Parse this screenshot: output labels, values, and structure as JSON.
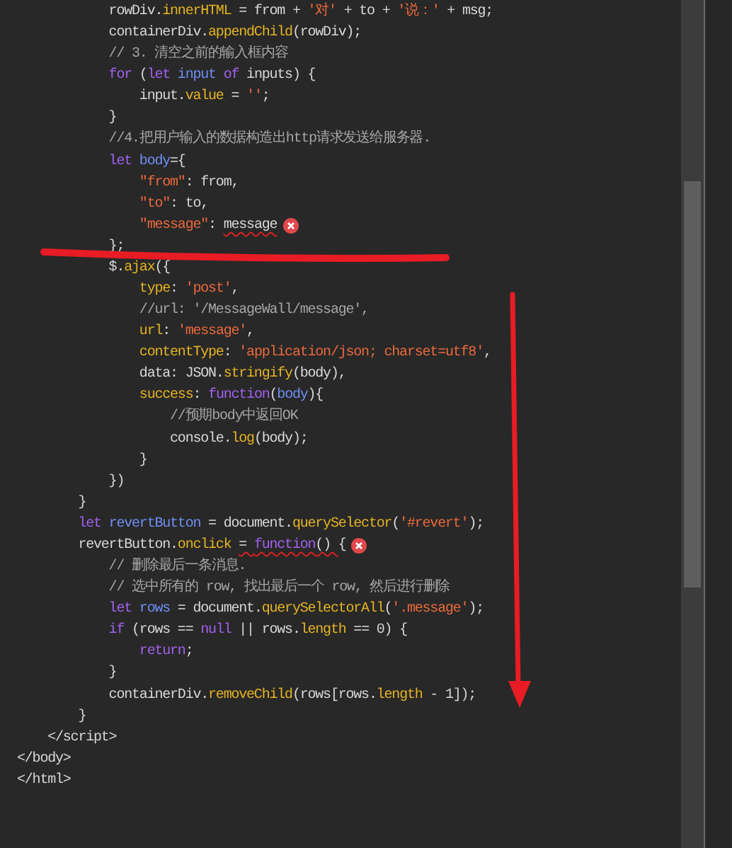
{
  "code_lines": [
    {
      "tokens": [
        {
          "t": "            rowDiv.",
          "kind": "plain"
        },
        {
          "t": "innerHTML",
          "kind": "prop"
        },
        {
          "t": " = from + ",
          "kind": "plain"
        },
        {
          "t": "'对'",
          "kind": "string"
        },
        {
          "t": " + to + ",
          "kind": "plain"
        },
        {
          "t": "'说：'",
          "kind": "string"
        },
        {
          "t": " + msg;",
          "kind": "plain"
        }
      ]
    },
    {
      "tokens": [
        {
          "t": "            containerDiv.",
          "kind": "plain"
        },
        {
          "t": "appendChild",
          "kind": "prop"
        },
        {
          "t": "(rowDiv);",
          "kind": "plain"
        }
      ]
    },
    {
      "tokens": [
        {
          "t": "            // 3. 清空之前的输入框内容",
          "kind": "comment"
        }
      ]
    },
    {
      "tokens": [
        {
          "t": "            for",
          "kind": "keyword"
        },
        {
          "t": " (",
          "kind": "plain"
        },
        {
          "t": "let",
          "kind": "keyword"
        },
        {
          "t": " input",
          "kind": "decl"
        },
        {
          "t": " of",
          "kind": "keyword"
        },
        {
          "t": " inputs) {",
          "kind": "plain"
        }
      ]
    },
    {
      "tokens": [
        {
          "t": "                input.",
          "kind": "plain"
        },
        {
          "t": "value",
          "kind": "prop"
        },
        {
          "t": " = ",
          "kind": "plain"
        },
        {
          "t": "''",
          "kind": "string"
        },
        {
          "t": ";",
          "kind": "plain"
        }
      ]
    },
    {
      "tokens": [
        {
          "t": "            }",
          "kind": "plain"
        }
      ]
    },
    {
      "tokens": [
        {
          "t": "            //4.把用户输入的数据构造出http请求发送给服务器.",
          "kind": "comment"
        }
      ]
    },
    {
      "tokens": [
        {
          "t": "            let",
          "kind": "keyword"
        },
        {
          "t": " body",
          "kind": "decl"
        },
        {
          "t": "={",
          "kind": "plain"
        }
      ]
    },
    {
      "tokens": [
        {
          "t": "                \"from\"",
          "kind": "string"
        },
        {
          "t": ": from,",
          "kind": "plain"
        }
      ]
    },
    {
      "tokens": [
        {
          "t": "                \"to\"",
          "kind": "string"
        },
        {
          "t": ": to,",
          "kind": "plain"
        }
      ]
    },
    {
      "tokens": [
        {
          "t": "                \"message\"",
          "kind": "string"
        },
        {
          "t": ": ",
          "kind": "plain"
        },
        {
          "t": "message",
          "kind": "plain",
          "squiggle": true
        }
      ],
      "error": true
    },
    {
      "tokens": [
        {
          "t": "            };",
          "kind": "plain"
        }
      ]
    },
    {
      "tokens": [
        {
          "t": "            $.",
          "kind": "plain"
        },
        {
          "t": "ajax",
          "kind": "prop"
        },
        {
          "t": "({",
          "kind": "plain"
        }
      ]
    },
    {
      "tokens": [
        {
          "t": "                type",
          "kind": "prop"
        },
        {
          "t": ": ",
          "kind": "plain"
        },
        {
          "t": "'post'",
          "kind": "string"
        },
        {
          "t": ",",
          "kind": "plain"
        }
      ]
    },
    {
      "tokens": [
        {
          "t": "                //url: '/MessageWall/message',",
          "kind": "comment"
        }
      ]
    },
    {
      "tokens": [
        {
          "t": "                url",
          "kind": "prop"
        },
        {
          "t": ": ",
          "kind": "plain"
        },
        {
          "t": "'message'",
          "kind": "string"
        },
        {
          "t": ",",
          "kind": "plain"
        }
      ]
    },
    {
      "tokens": [
        {
          "t": "                contentType",
          "kind": "prop"
        },
        {
          "t": ": ",
          "kind": "plain"
        },
        {
          "t": "'application/json; charset=utf8'",
          "kind": "string"
        },
        {
          "t": ",",
          "kind": "plain"
        }
      ]
    },
    {
      "tokens": [
        {
          "t": "                data: JSON.",
          "kind": "plain"
        },
        {
          "t": "stringify",
          "kind": "prop"
        },
        {
          "t": "(body),",
          "kind": "plain"
        }
      ]
    },
    {
      "tokens": [
        {
          "t": "                success",
          "kind": "prop"
        },
        {
          "t": ": ",
          "kind": "plain"
        },
        {
          "t": "function",
          "kind": "keyword"
        },
        {
          "t": "(",
          "kind": "plain"
        },
        {
          "t": "body",
          "kind": "decl"
        },
        {
          "t": "){",
          "kind": "plain"
        }
      ]
    },
    {
      "tokens": [
        {
          "t": "                    //预期body中返回OK",
          "kind": "comment"
        }
      ]
    },
    {
      "tokens": [
        {
          "t": "                    console.",
          "kind": "plain"
        },
        {
          "t": "log",
          "kind": "prop"
        },
        {
          "t": "(body);",
          "kind": "plain"
        }
      ]
    },
    {
      "tokens": [
        {
          "t": "                }",
          "kind": "plain"
        }
      ]
    },
    {
      "tokens": [
        {
          "t": "            })",
          "kind": "plain"
        }
      ]
    },
    {
      "tokens": [
        {
          "t": "        }",
          "kind": "plain"
        }
      ]
    },
    {
      "tokens": [
        {
          "t": "        let",
          "kind": "keyword"
        },
        {
          "t": " revertButton",
          "kind": "decl"
        },
        {
          "t": " = document.",
          "kind": "plain"
        },
        {
          "t": "querySelector",
          "kind": "prop"
        },
        {
          "t": "(",
          "kind": "plain"
        },
        {
          "t": "'#revert'",
          "kind": "string"
        },
        {
          "t": ");",
          "kind": "plain"
        }
      ]
    },
    {
      "tokens": [
        {
          "t": "        revertButton.",
          "kind": "plain"
        },
        {
          "t": "onclick ",
          "kind": "prop"
        },
        {
          "t": "= ",
          "kind": "plain",
          "squiggle": true
        },
        {
          "t": "function",
          "kind": "keyword",
          "squiggle": true
        },
        {
          "t": "() ",
          "kind": "plain",
          "squiggle": true
        },
        {
          "t": "{",
          "kind": "plain"
        }
      ],
      "error": true
    },
    {
      "tokens": [
        {
          "t": "            // 删除最后一条消息.",
          "kind": "comment"
        }
      ]
    },
    {
      "tokens": [
        {
          "t": "            // 选中所有的 row, 找出最后一个 row, 然后进行删除",
          "kind": "comment"
        }
      ]
    },
    {
      "tokens": [
        {
          "t": "            let",
          "kind": "keyword"
        },
        {
          "t": " rows",
          "kind": "decl"
        },
        {
          "t": " = document.",
          "kind": "plain"
        },
        {
          "t": "querySelectorAll",
          "kind": "prop"
        },
        {
          "t": "(",
          "kind": "plain"
        },
        {
          "t": "'.message'",
          "kind": "string"
        },
        {
          "t": ");",
          "kind": "plain"
        }
      ]
    },
    {
      "tokens": [
        {
          "t": "            if",
          "kind": "keyword"
        },
        {
          "t": " (rows == ",
          "kind": "plain"
        },
        {
          "t": "null",
          "kind": "keyword"
        },
        {
          "t": " || rows.",
          "kind": "plain"
        },
        {
          "t": "length",
          "kind": "prop"
        },
        {
          "t": " == 0) {",
          "kind": "plain"
        }
      ]
    },
    {
      "tokens": [
        {
          "t": "                return",
          "kind": "keyword"
        },
        {
          "t": ";",
          "kind": "plain"
        }
      ]
    },
    {
      "tokens": [
        {
          "t": "            }",
          "kind": "plain"
        }
      ]
    },
    {
      "tokens": [
        {
          "t": "            containerDiv.",
          "kind": "plain"
        },
        {
          "t": "removeChild",
          "kind": "prop"
        },
        {
          "t": "(rows[rows.",
          "kind": "plain"
        },
        {
          "t": "length",
          "kind": "prop"
        },
        {
          "t": " - 1]);",
          "kind": "plain"
        }
      ]
    },
    {
      "tokens": [
        {
          "t": "        }",
          "kind": "plain"
        }
      ]
    },
    {
      "tokens": [
        {
          "t": "    </script>",
          "kind": "plain"
        }
      ]
    },
    {
      "tokens": [
        {
          "t": "</body>",
          "kind": "plain"
        }
      ]
    },
    {
      "tokens": [
        {
          "t": "</html>",
          "kind": "plain"
        }
      ]
    }
  ]
}
